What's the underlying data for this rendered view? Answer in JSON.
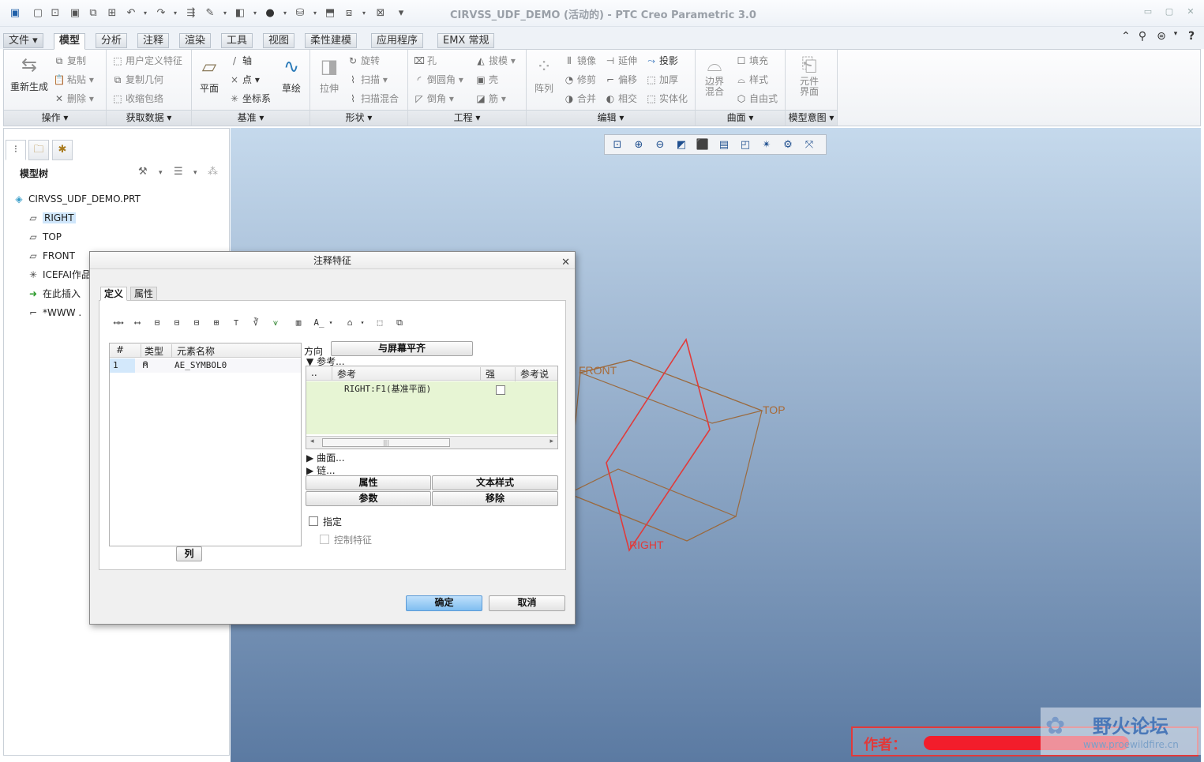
{
  "window": {
    "title": "CIRVSS_UDF_DEMO (活动的) - PTC Creo Parametric 3.0"
  },
  "ribbon_tabs": [
    {
      "label": "文件"
    },
    {
      "label": "模型"
    },
    {
      "label": "分析"
    },
    {
      "label": "注释"
    },
    {
      "label": "渲染"
    },
    {
      "label": "工具"
    },
    {
      "label": "视图"
    },
    {
      "label": "柔性建模"
    },
    {
      "label": "应用程序"
    },
    {
      "label": "EMX 常规"
    }
  ],
  "ribbon": {
    "ops": {
      "regen": "重新生成",
      "copy": "复制",
      "paste": "粘贴",
      "delete": "删除",
      "footer": "操作"
    },
    "getdata": {
      "udf": "用户定义特征",
      "copygeom": "复制几何",
      "shrink": "收缩包络",
      "footer": "获取数据"
    },
    "datum": {
      "plane": "平面",
      "axis": "轴",
      "point": "点",
      "csys": "坐标系",
      "sketch": "草绘",
      "footer": "基准"
    },
    "shapes": {
      "extrude": "拉伸",
      "revolve": "旋转",
      "sweep": "扫描",
      "swept_blend": "扫描混合",
      "footer": "形状"
    },
    "engineering": {
      "hole": "孔",
      "round": "倒圆角",
      "chamfer": "倒角",
      "draft": "拔模",
      "shell": "壳",
      "rib": "筋",
      "footer": "工程"
    },
    "editing": {
      "pattern": "阵列",
      "mirror": "镜像",
      "trim": "修剪",
      "merge": "合并",
      "extend": "延伸",
      "offset": "偏移",
      "intersect": "相交",
      "project": "投影",
      "thicken": "加厚",
      "solidify": "实体化",
      "footer": "编辑"
    },
    "surfaces": {
      "boundary": "边界混合",
      "fill": "填充",
      "style": "样式",
      "freestyle": "自由式",
      "footer": "曲面"
    },
    "intent": {
      "component": "元件界面",
      "footer": "模型意图"
    }
  },
  "model_tree": {
    "title": "模型树",
    "items": [
      {
        "label": "CIRVSS_UDF_DEMO.PRT"
      },
      {
        "label": "RIGHT"
      },
      {
        "label": "TOP"
      },
      {
        "label": "FRONT"
      },
      {
        "label": "ICEFAI作品"
      },
      {
        "label": "在此插入"
      },
      {
        "label": "*WWW ."
      }
    ]
  },
  "viewport": {
    "labels": {
      "front": "FRONT",
      "top": "TOP",
      "right": "RIGHT"
    }
  },
  "dialog": {
    "title": "注释特征",
    "tabs": [
      {
        "label": "定义"
      },
      {
        "label": "属性"
      }
    ],
    "element_table": {
      "headers": [
        "#",
        "类型",
        "元素名称"
      ],
      "rows": [
        {
          "num": "1",
          "name": "AE_SYMBOL0"
        }
      ]
    },
    "columns_button": "列",
    "direction_label": "方向",
    "align_button": "与屏幕平齐",
    "references_label": "参考...",
    "ref_table": {
      "headers": [
        "..",
        "参考",
        "强",
        "参考说明"
      ],
      "rows": [
        {
          "ref": "RIGHT:F1(基准平面)",
          "strong": false
        }
      ]
    },
    "surfaces_label": "曲面...",
    "chain_label": "链...",
    "buttons": {
      "properties": "属性",
      "text_style": "文本样式",
      "parameters": "参数",
      "remove": "移除"
    },
    "specify": {
      "label": "指定",
      "checked": false
    },
    "control_feature": {
      "label": "控制特征",
      "checked": false
    },
    "ok": "确定",
    "cancel": "取消"
  },
  "watermark": {
    "author": "作者：",
    "site_name": "野火论坛",
    "url": "www.proewildfire.cn"
  }
}
